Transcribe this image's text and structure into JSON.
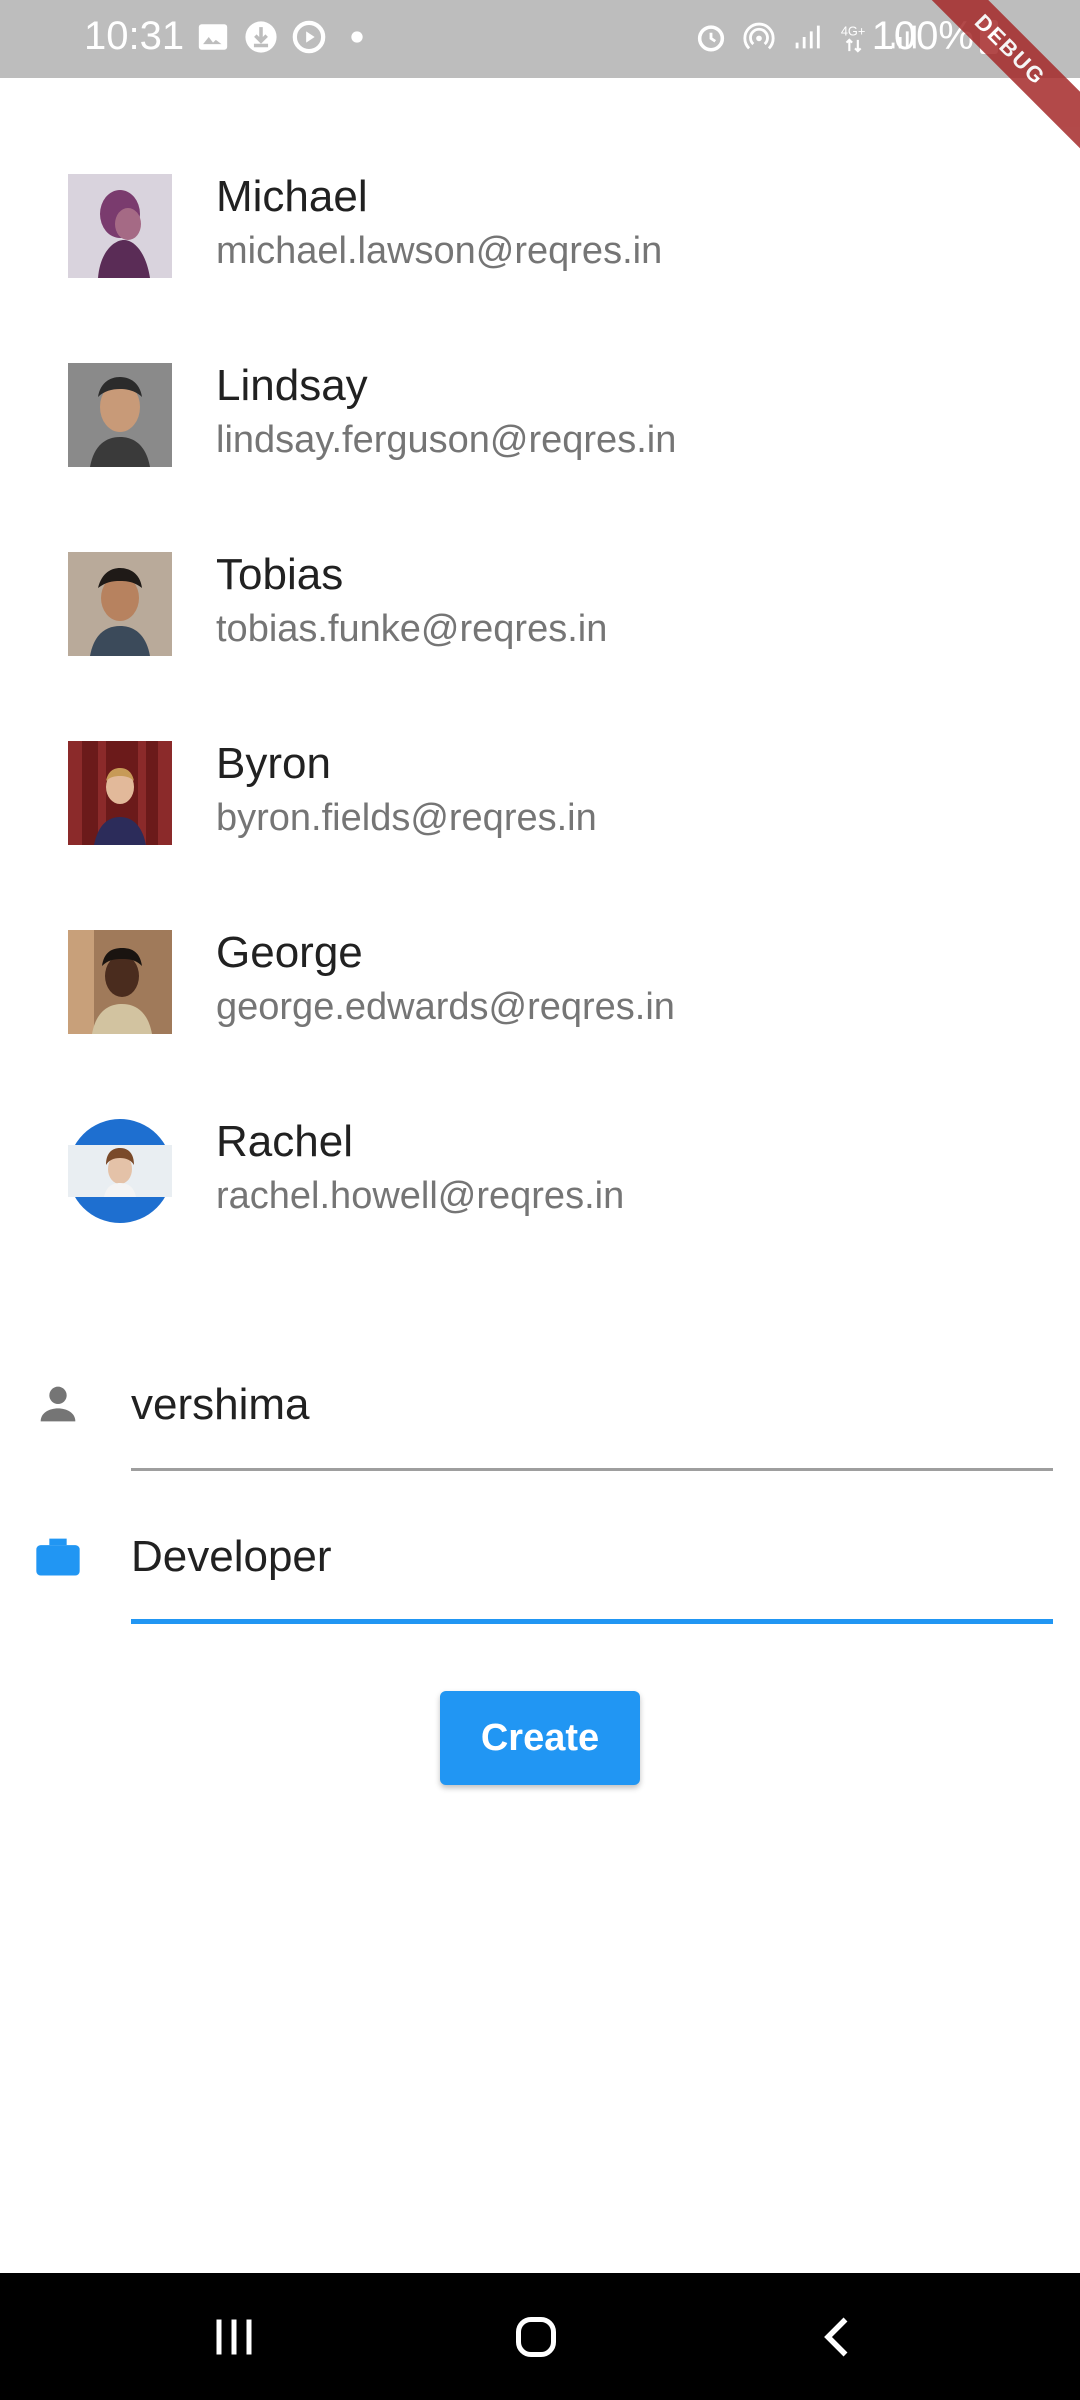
{
  "status_bar": {
    "time": "10:31",
    "battery": "100%",
    "debug_label": "DEBUG",
    "left_icons": [
      "image-icon",
      "download-icon",
      "media-icon",
      "dot-icon"
    ],
    "right_icons": [
      "alarm-icon",
      "hotspot-icon",
      "signal-icon",
      "lte-icon",
      "signal-icon"
    ]
  },
  "users": [
    {
      "name": "Michael",
      "email": "michael.lawson@reqres.in"
    },
    {
      "name": "Lindsay",
      "email": "lindsay.ferguson@reqres.in"
    },
    {
      "name": "Tobias",
      "email": "tobias.funke@reqres.in"
    },
    {
      "name": "Byron",
      "email": "byron.fields@reqres.in"
    },
    {
      "name": "George",
      "email": "george.edwards@reqres.in"
    },
    {
      "name": "Rachel",
      "email": "rachel.howell@reqres.in"
    }
  ],
  "form": {
    "name_value": "vershima",
    "job_value": "Developer",
    "create_label": "Create"
  },
  "colors": {
    "accent": "#2196f3",
    "icon_grey": "#757575",
    "status_bar": "#bdbdbd"
  },
  "nav": {
    "items": [
      "recent-apps-icon",
      "home-icon",
      "back-icon"
    ]
  }
}
